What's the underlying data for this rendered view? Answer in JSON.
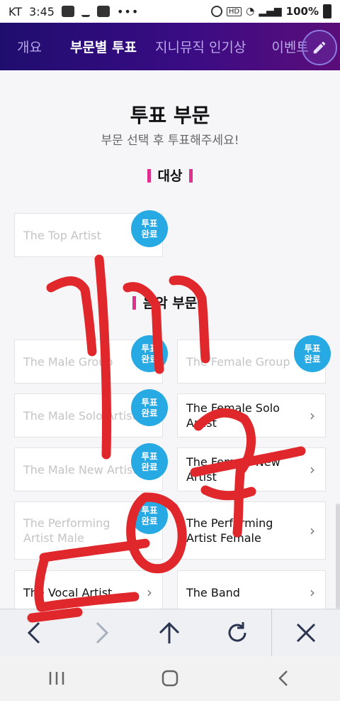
{
  "status_bar": {
    "carrier": "KT",
    "time": "3:45",
    "battery": "100%"
  },
  "tabs": [
    {
      "label": "개요"
    },
    {
      "label": "부문별 투표"
    },
    {
      "label": "지니뮤직 인기상"
    },
    {
      "label": "이벤트"
    }
  ],
  "page": {
    "title": "투표 부문",
    "subtitle": "부문 선택 후 투표해주세요!"
  },
  "grand_prize": {
    "heading": "대상",
    "cards": [
      {
        "label": "The Top Artist",
        "status": "투표\n완료"
      }
    ]
  },
  "music": {
    "heading": "음악 부문",
    "cards": [
      {
        "label": "The Male Group",
        "voted": true,
        "status": "투표\n완료"
      },
      {
        "label": "The Female Group",
        "voted": true,
        "status": "투표\n완료"
      },
      {
        "label": "The Male Solo Artist",
        "voted": true,
        "status": "투표\n완료"
      },
      {
        "label": "The Female Solo Artist",
        "voted": false
      },
      {
        "label": "The Male New Artist",
        "voted": true,
        "status": "투표\n완료"
      },
      {
        "label": "The Female New Artist",
        "voted": false
      },
      {
        "label": "The Performing Artist Male",
        "voted": true,
        "status": "투표\n완료"
      },
      {
        "label": "The Performing Artist Female",
        "voted": false
      },
      {
        "label": "The Vocal Artist",
        "voted": false
      },
      {
        "label": "The Band",
        "voted": false
      }
    ]
  },
  "icons": {
    "edit": "pencil-icon",
    "back": "chevron-left-icon",
    "forward": "chevron-right-icon",
    "up": "arrow-up-icon",
    "refresh": "refresh-icon",
    "close": "close-icon"
  },
  "colors": {
    "accent": "#e0308f",
    "badge": "#27a9e3",
    "tab_bg": "#2a0c78",
    "scribble": "#e0282c"
  }
}
